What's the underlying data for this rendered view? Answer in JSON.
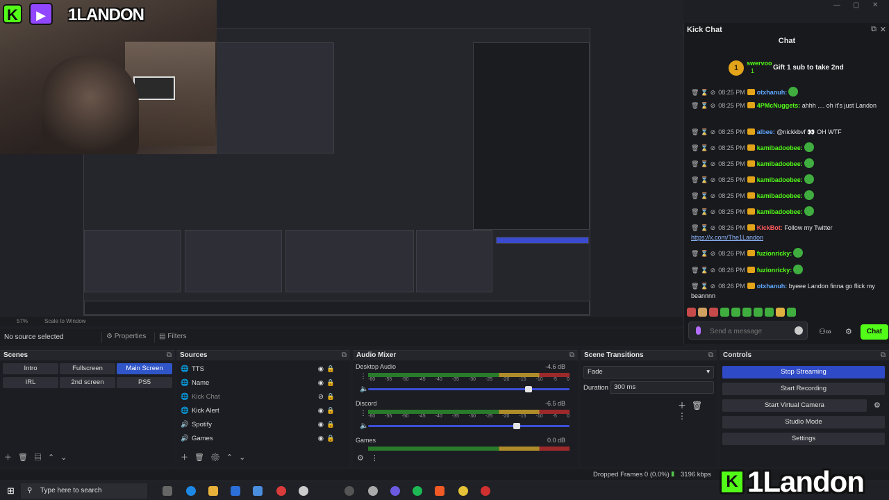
{
  "webcam": {
    "kick_badge": "K",
    "twitch_badge": "▶",
    "streamer_name": "1LANDON"
  },
  "chat_dock": {
    "window_title": "Kick Chat",
    "header": "Chat",
    "pinned": {
      "user": "swervoo",
      "count": "1",
      "text": "Gift 1 sub to take 2nd"
    },
    "messages": [
      {
        "time": "08:25 PM",
        "user": "otxhanuh",
        "text": "",
        "color": "blue"
      },
      {
        "time": "08:25 PM",
        "user": "4PMcNuggets",
        "text": "ahhh .... oh it's just Landon"
      },
      {
        "time": "08:25 PM",
        "user": "albee",
        "text": "@nickkbvf 👀 OH WTF",
        "color": "blue"
      },
      {
        "time": "08:25 PM",
        "user": "kamibadoobee",
        "text": ""
      },
      {
        "time": "08:25 PM",
        "user": "kamibadoobee",
        "text": ""
      },
      {
        "time": "08:25 PM",
        "user": "kamibadoobee",
        "text": ""
      },
      {
        "time": "08:25 PM",
        "user": "kamibadoobee",
        "text": ""
      },
      {
        "time": "08:25 PM",
        "user": "kamibadoobee",
        "text": ""
      },
      {
        "time": "08:26 PM",
        "user": "KickBot",
        "text": "Follow my Twitter",
        "link": "https://x.com/The1Landon",
        "color": "red"
      },
      {
        "time": "08:26 PM",
        "user": "fuzionricky",
        "text": ""
      },
      {
        "time": "08:26 PM",
        "user": "fuzionricky",
        "text": ""
      },
      {
        "time": "08:26 PM",
        "user": "otxhanuh",
        "text": "byeee Landon finna go flick my beannnn",
        "color": "blue"
      }
    ],
    "input_placeholder": "Send a message",
    "send_label": "Chat"
  },
  "preview": {
    "zoom": "57%",
    "scale_mode": "Scale to Window"
  },
  "source_bar": {
    "no_source": "No source selected",
    "properties": "Properties",
    "filters": "Filters"
  },
  "scenes": {
    "title": "Scenes",
    "items": [
      "Intro",
      "Fullscreen",
      "Main Screen",
      "IRL",
      "2nd screen",
      "PS5"
    ],
    "active": "Main Screen"
  },
  "sources": {
    "title": "Sources",
    "items": [
      {
        "name": "TTS",
        "icon": "🌐"
      },
      {
        "name": "Name",
        "icon": "🌐"
      },
      {
        "name": "Kick Chat",
        "icon": "🌐",
        "hidden": true
      },
      {
        "name": "Kick Alert",
        "icon": "🌐"
      },
      {
        "name": "Spotify",
        "icon": "🔊"
      },
      {
        "name": "Games",
        "icon": "🔊"
      }
    ]
  },
  "mixer": {
    "title": "Audio Mixer",
    "scale": [
      "-60",
      "-55",
      "-50",
      "-45",
      "-40",
      "-35",
      "-30",
      "-25",
      "-20",
      "-15",
      "-10",
      "-5",
      "0"
    ],
    "channels": [
      {
        "name": "Desktop Audio",
        "db": "-4.6 dB",
        "level": 0.82
      },
      {
        "name": "Discord",
        "db": "-6.5 dB",
        "level": 0.76
      },
      {
        "name": "Games",
        "db": "0.0 dB",
        "level": 1.0
      }
    ]
  },
  "transitions": {
    "title": "Scene Transitions",
    "selected": "Fade",
    "duration_label": "Duration",
    "duration": "300 ms"
  },
  "controls": {
    "title": "Controls",
    "buttons": [
      "Stop Streaming",
      "Start Recording",
      "Start Virtual Camera",
      "Studio Mode",
      "Settings"
    ]
  },
  "status": {
    "dropped": "Dropped Frames 0 (0.0%)",
    "bitrate": "3196 kbps"
  },
  "taskbar": {
    "search_placeholder": "Type here to search"
  },
  "brand": {
    "text": "1Landon",
    "k": "K"
  }
}
